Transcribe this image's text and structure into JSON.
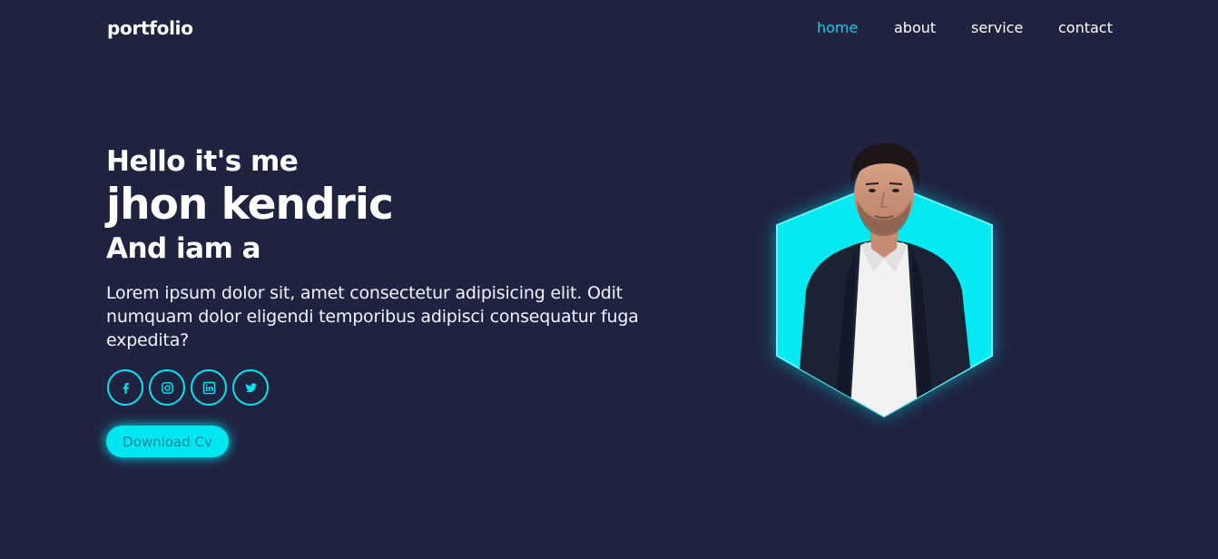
{
  "header": {
    "logo": "portfolio",
    "nav": [
      {
        "label": "home",
        "active": true
      },
      {
        "label": "about",
        "active": false
      },
      {
        "label": "service",
        "active": false
      },
      {
        "label": "contact",
        "active": false
      }
    ]
  },
  "hero": {
    "greeting": "Hello it's me",
    "name": "jhon kendric",
    "role_prefix": "And iam a",
    "description": "Lorem ipsum dolor sit, amet consectetur adipisicing elit. Odit numquam dolor eligendi temporibus adipisci consequatur fuga expedita?",
    "socials": [
      {
        "icon": "facebook-icon"
      },
      {
        "icon": "instagram-icon"
      },
      {
        "icon": "linkedin-icon"
      },
      {
        "icon": "twitter-icon"
      }
    ],
    "cta_label": "Download Cv"
  },
  "colors": {
    "background": "#1f2340",
    "accent": "#00e6f0",
    "nav_active": "#1ec9e6",
    "text": "#ffffff"
  }
}
